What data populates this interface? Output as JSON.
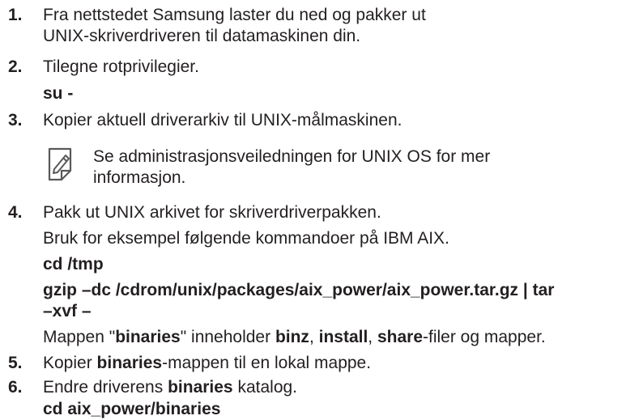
{
  "steps": [
    {
      "num": "1.",
      "lines": [
        "Fra nettstedet Samsung laster du ned og pakker ut",
        "UNIX-skriverdriveren til datamaskinen din."
      ]
    },
    {
      "num": "2.",
      "text": "Tilegne rotprivilegier.",
      "cmd": "su -"
    },
    {
      "num": "3.",
      "text": "Kopier aktuell driverarkiv til UNIX-målmaskinen.",
      "note": {
        "icon": "note-pencil-icon",
        "lines": [
          "Se administrasjonsveiledningen for UNIX OS for mer",
          "informasjon."
        ]
      }
    },
    {
      "num": "4.",
      "text": "Pakk ut UNIX arkivet for skriverdriverpakken.",
      "text2": "Bruk for eksempel følgende kommandoer på IBM AIX.",
      "cmd1": "cd /tmp",
      "cmd2_line1": "gzip –dc /cdrom/unix/packages/aix_power/aix_power.tar.gz | tar",
      "cmd2_line2": "–xvf –",
      "folder": {
        "pre": "Mappen \"",
        "binaries": "binaries",
        "mid1": "\" inneholder ",
        "binz": "binz",
        "sep1": ", ",
        "install": "install",
        "sep2": ", ",
        "share": "share",
        "post": "-filer og mapper."
      }
    },
    {
      "num": "5.",
      "bold": "binaries",
      "pre": "Kopier ",
      "post": "-mappen til en lokal mappe."
    },
    {
      "num": "6.",
      "pre": "Endre driverens ",
      "bold": "binaries",
      "post": " katalog.",
      "cmd": "cd aix_power/binaries"
    }
  ]
}
